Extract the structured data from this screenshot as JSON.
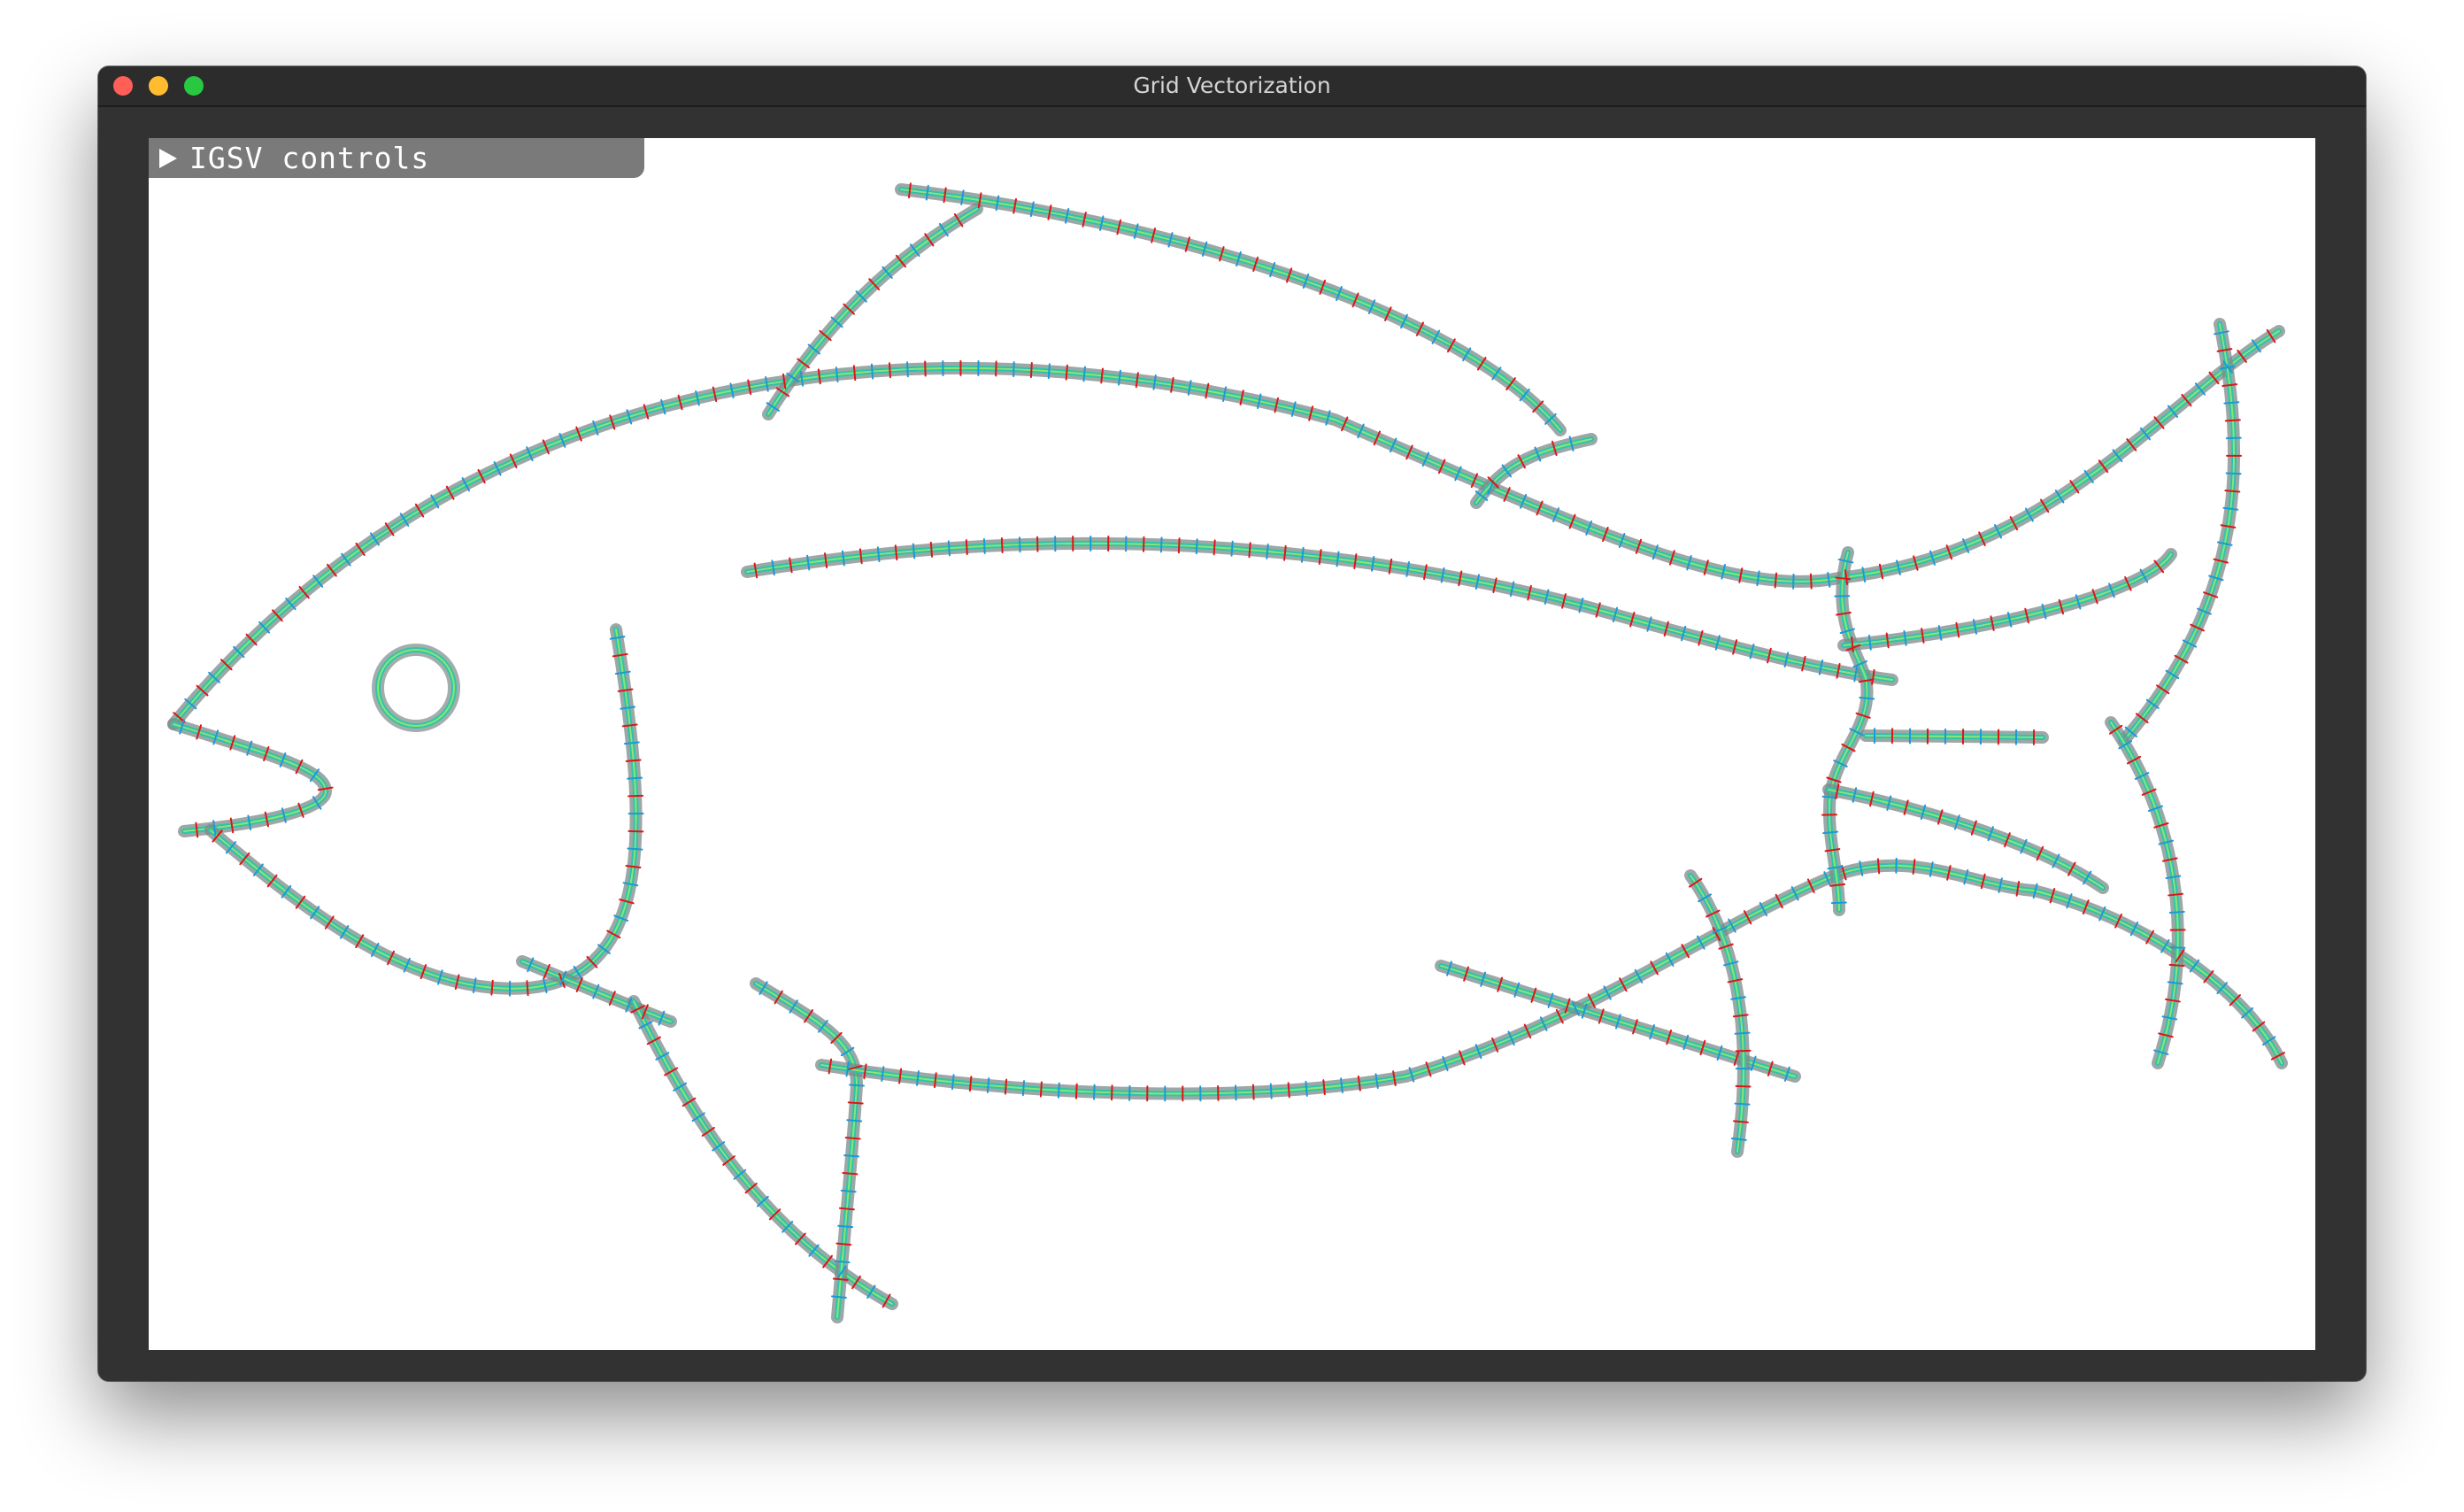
{
  "window": {
    "title": "Grid Vectorization"
  },
  "controls": {
    "label": "IGSV controls",
    "icon": "triangle-right-icon",
    "expanded": false
  },
  "colors": {
    "close": "#ff5f57",
    "minimize": "#febc2e",
    "zoom": "#28c840",
    "stroke_shadow": "#7d8a8a",
    "stroke_main": "#2ec7a4",
    "stroke_blue": "#1f9fd6",
    "stroke_light": "#8de37a",
    "tick_red": "#e01515",
    "tick_blue": "#1a9ad8"
  }
}
